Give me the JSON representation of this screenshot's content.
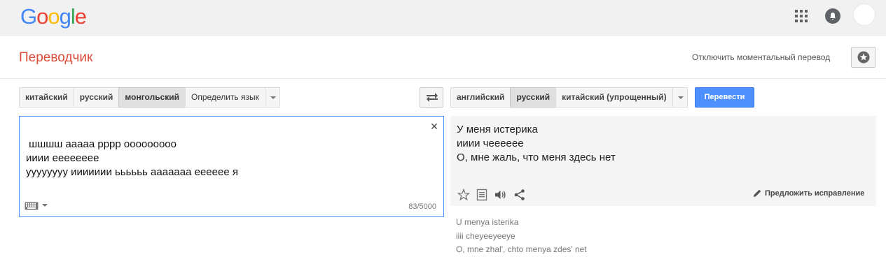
{
  "header": {
    "logo_letters": [
      {
        "ch": "G",
        "color": "#4285f4"
      },
      {
        "ch": "o",
        "color": "#ea4335"
      },
      {
        "ch": "o",
        "color": "#fbbc05"
      },
      {
        "ch": "g",
        "color": "#4285f4"
      },
      {
        "ch": "l",
        "color": "#34a853"
      },
      {
        "ch": "e",
        "color": "#ea4335"
      }
    ],
    "icons": [
      "apps-grid-icon",
      "bell-icon",
      "avatar"
    ]
  },
  "app": {
    "title": "Переводчик",
    "instant_toggle_label": "Отключить моментальный перевод"
  },
  "source_languages": {
    "buttons": [
      {
        "label": "китайский",
        "active": false
      },
      {
        "label": "русский",
        "active": false
      },
      {
        "label": "монгольский",
        "active": true
      },
      {
        "label": "Определить язык",
        "active": false
      }
    ]
  },
  "target_languages": {
    "buttons": [
      {
        "label": "английский",
        "active": false
      },
      {
        "label": "русский",
        "active": true
      },
      {
        "label": "китайский (упрощенный)",
        "active": false
      }
    ],
    "translate_label": "Перевести"
  },
  "source": {
    "text": " шшшш ааааа рррр ооооооооо\nииии ееееееее\nуууууууу иииииии ьььььь ааааааа ееееее я",
    "char_count": "83/5000"
  },
  "result": {
    "text": "У меня истерика\nииии чееееее\nО, мне жаль, что меня здесь нет",
    "suggest_label": "Предложить исправление",
    "transliteration": "U menya isterika\niiii cheyeeyeeye\nO, mne zhal', chto menya zdes' net"
  },
  "colors": {
    "title": "#dd4b39",
    "primary_button": "#4d90fe",
    "focus_border": "#4d90fe"
  }
}
